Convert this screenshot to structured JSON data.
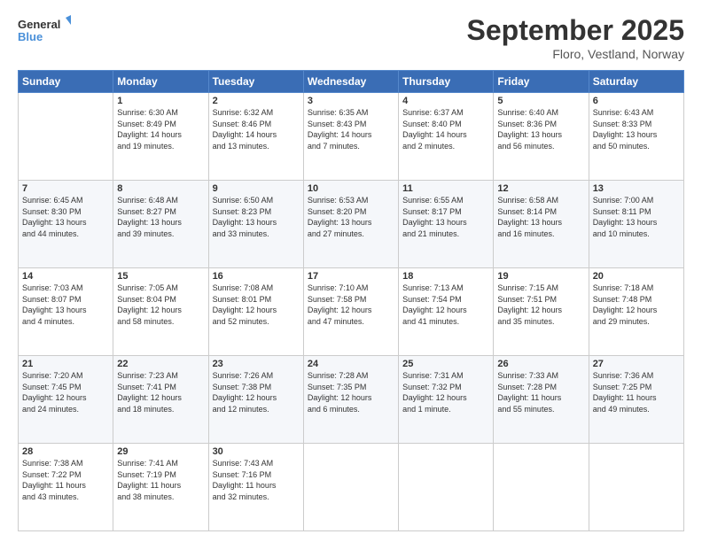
{
  "header": {
    "logo_line1": "General",
    "logo_line2": "Blue",
    "month": "September 2025",
    "location": "Floro, Vestland, Norway"
  },
  "weekdays": [
    "Sunday",
    "Monday",
    "Tuesday",
    "Wednesday",
    "Thursday",
    "Friday",
    "Saturday"
  ],
  "weeks": [
    [
      {
        "day": "",
        "info": ""
      },
      {
        "day": "1",
        "info": "Sunrise: 6:30 AM\nSunset: 8:49 PM\nDaylight: 14 hours\nand 19 minutes."
      },
      {
        "day": "2",
        "info": "Sunrise: 6:32 AM\nSunset: 8:46 PM\nDaylight: 14 hours\nand 13 minutes."
      },
      {
        "day": "3",
        "info": "Sunrise: 6:35 AM\nSunset: 8:43 PM\nDaylight: 14 hours\nand 7 minutes."
      },
      {
        "day": "4",
        "info": "Sunrise: 6:37 AM\nSunset: 8:40 PM\nDaylight: 14 hours\nand 2 minutes."
      },
      {
        "day": "5",
        "info": "Sunrise: 6:40 AM\nSunset: 8:36 PM\nDaylight: 13 hours\nand 56 minutes."
      },
      {
        "day": "6",
        "info": "Sunrise: 6:43 AM\nSunset: 8:33 PM\nDaylight: 13 hours\nand 50 minutes."
      }
    ],
    [
      {
        "day": "7",
        "info": "Sunrise: 6:45 AM\nSunset: 8:30 PM\nDaylight: 13 hours\nand 44 minutes."
      },
      {
        "day": "8",
        "info": "Sunrise: 6:48 AM\nSunset: 8:27 PM\nDaylight: 13 hours\nand 39 minutes."
      },
      {
        "day": "9",
        "info": "Sunrise: 6:50 AM\nSunset: 8:23 PM\nDaylight: 13 hours\nand 33 minutes."
      },
      {
        "day": "10",
        "info": "Sunrise: 6:53 AM\nSunset: 8:20 PM\nDaylight: 13 hours\nand 27 minutes."
      },
      {
        "day": "11",
        "info": "Sunrise: 6:55 AM\nSunset: 8:17 PM\nDaylight: 13 hours\nand 21 minutes."
      },
      {
        "day": "12",
        "info": "Sunrise: 6:58 AM\nSunset: 8:14 PM\nDaylight: 13 hours\nand 16 minutes."
      },
      {
        "day": "13",
        "info": "Sunrise: 7:00 AM\nSunset: 8:11 PM\nDaylight: 13 hours\nand 10 minutes."
      }
    ],
    [
      {
        "day": "14",
        "info": "Sunrise: 7:03 AM\nSunset: 8:07 PM\nDaylight: 13 hours\nand 4 minutes."
      },
      {
        "day": "15",
        "info": "Sunrise: 7:05 AM\nSunset: 8:04 PM\nDaylight: 12 hours\nand 58 minutes."
      },
      {
        "day": "16",
        "info": "Sunrise: 7:08 AM\nSunset: 8:01 PM\nDaylight: 12 hours\nand 52 minutes."
      },
      {
        "day": "17",
        "info": "Sunrise: 7:10 AM\nSunset: 7:58 PM\nDaylight: 12 hours\nand 47 minutes."
      },
      {
        "day": "18",
        "info": "Sunrise: 7:13 AM\nSunset: 7:54 PM\nDaylight: 12 hours\nand 41 minutes."
      },
      {
        "day": "19",
        "info": "Sunrise: 7:15 AM\nSunset: 7:51 PM\nDaylight: 12 hours\nand 35 minutes."
      },
      {
        "day": "20",
        "info": "Sunrise: 7:18 AM\nSunset: 7:48 PM\nDaylight: 12 hours\nand 29 minutes."
      }
    ],
    [
      {
        "day": "21",
        "info": "Sunrise: 7:20 AM\nSunset: 7:45 PM\nDaylight: 12 hours\nand 24 minutes."
      },
      {
        "day": "22",
        "info": "Sunrise: 7:23 AM\nSunset: 7:41 PM\nDaylight: 12 hours\nand 18 minutes."
      },
      {
        "day": "23",
        "info": "Sunrise: 7:26 AM\nSunset: 7:38 PM\nDaylight: 12 hours\nand 12 minutes."
      },
      {
        "day": "24",
        "info": "Sunrise: 7:28 AM\nSunset: 7:35 PM\nDaylight: 12 hours\nand 6 minutes."
      },
      {
        "day": "25",
        "info": "Sunrise: 7:31 AM\nSunset: 7:32 PM\nDaylight: 12 hours\nand 1 minute."
      },
      {
        "day": "26",
        "info": "Sunrise: 7:33 AM\nSunset: 7:28 PM\nDaylight: 11 hours\nand 55 minutes."
      },
      {
        "day": "27",
        "info": "Sunrise: 7:36 AM\nSunset: 7:25 PM\nDaylight: 11 hours\nand 49 minutes."
      }
    ],
    [
      {
        "day": "28",
        "info": "Sunrise: 7:38 AM\nSunset: 7:22 PM\nDaylight: 11 hours\nand 43 minutes."
      },
      {
        "day": "29",
        "info": "Sunrise: 7:41 AM\nSunset: 7:19 PM\nDaylight: 11 hours\nand 38 minutes."
      },
      {
        "day": "30",
        "info": "Sunrise: 7:43 AM\nSunset: 7:16 PM\nDaylight: 11 hours\nand 32 minutes."
      },
      {
        "day": "",
        "info": ""
      },
      {
        "day": "",
        "info": ""
      },
      {
        "day": "",
        "info": ""
      },
      {
        "day": "",
        "info": ""
      }
    ]
  ]
}
